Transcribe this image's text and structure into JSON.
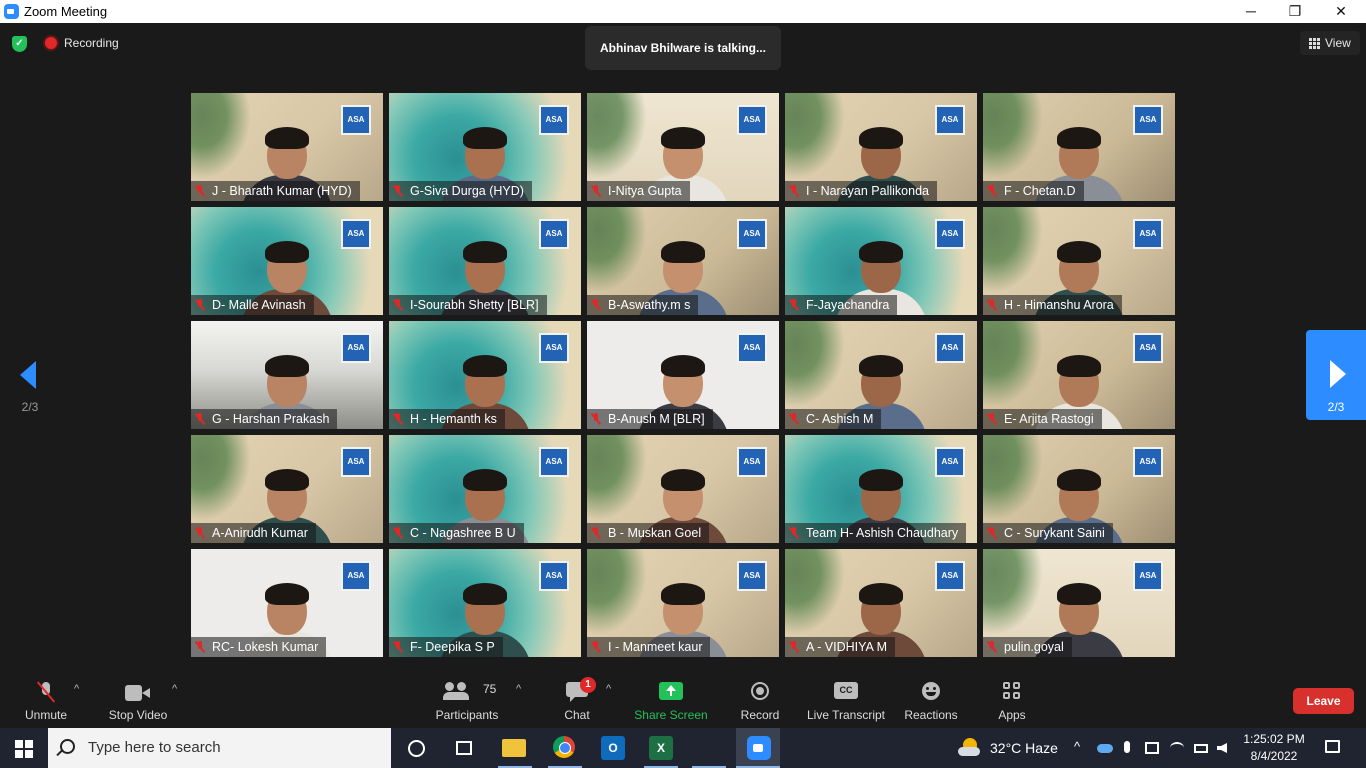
{
  "window": {
    "title": "Zoom Meeting",
    "minimize": "─",
    "maximize": "❐",
    "close": "✕"
  },
  "meeting": {
    "recording_label": "Recording",
    "talking_text": "Abhinav Bhilware is talking...",
    "view_label": "View",
    "page_indicator": "2/3",
    "logo_text": "ASA"
  },
  "participants": [
    {
      "name": "J - Bharath Kumar (HYD)",
      "bg": "bg-a"
    },
    {
      "name": "G-Siva Durga (HYD)",
      "bg": "bg-teal"
    },
    {
      "name": "I-Nitya Gupta",
      "bg": "bg-c"
    },
    {
      "name": "I - Narayan Pallikonda",
      "bg": "bg-a"
    },
    {
      "name": "F - Chetan.D",
      "bg": "bg-b"
    },
    {
      "name": "D- Malle Avinash",
      "bg": "bg-teal"
    },
    {
      "name": "I-Sourabh Shetty [BLR]",
      "bg": "bg-teal"
    },
    {
      "name": "B-Aswathy.m s",
      "bg": "bg-b"
    },
    {
      "name": "F-Jayachandra",
      "bg": "bg-teal"
    },
    {
      "name": "H - Himanshu Arora",
      "bg": "bg-a"
    },
    {
      "name": "G - Harshan Prakash",
      "bg": "bg-room"
    },
    {
      "name": "H - Hemanth ks",
      "bg": "bg-teal"
    },
    {
      "name": "B-Anush M [BLR]",
      "bg": "bg-wall"
    },
    {
      "name": "C- Ashish M",
      "bg": "bg-a"
    },
    {
      "name": "E- Arjita Rastogi",
      "bg": "bg-b"
    },
    {
      "name": "A-Anirudh Kumar",
      "bg": "bg-a"
    },
    {
      "name": "C - Nagashree B U",
      "bg": "bg-teal"
    },
    {
      "name": "B - Muskan Goel",
      "bg": "bg-a"
    },
    {
      "name": "Team H- Ashish Chaudhary",
      "bg": "bg-teal"
    },
    {
      "name": "C - Surykant Saini",
      "bg": "bg-b"
    },
    {
      "name": "RC- Lokesh Kumar",
      "bg": "bg-wall"
    },
    {
      "name": "F- Deepika S P",
      "bg": "bg-teal"
    },
    {
      "name": "I - Manmeet kaur",
      "bg": "bg-a"
    },
    {
      "name": "A - VIDHIYA M",
      "bg": "bg-a"
    },
    {
      "name": "pulin.goyal",
      "bg": "bg-c"
    }
  ],
  "controls": {
    "unmute": "Unmute",
    "stop_video": "Stop Video",
    "participants": "Participants",
    "participant_count": "75",
    "chat": "Chat",
    "chat_badge": "1",
    "share_screen": "Share Screen",
    "record": "Record",
    "live_transcript": "Live Transcript",
    "cc_text": "CC",
    "reactions": "Reactions",
    "apps": "Apps",
    "leave": "Leave",
    "caret": "^"
  },
  "taskbar": {
    "search_placeholder": "Type here to search",
    "outlook_letter": "O",
    "excel_letter": "X",
    "weather": "32°C  Haze",
    "tray_chevron": "^",
    "time": "1:25:02 PM",
    "date": "8/4/2022"
  },
  "colors": {
    "accent_blue": "#2d8cff",
    "share_green": "#23c15a",
    "leave_red": "#d8302d",
    "muted_red": "#e02828"
  }
}
